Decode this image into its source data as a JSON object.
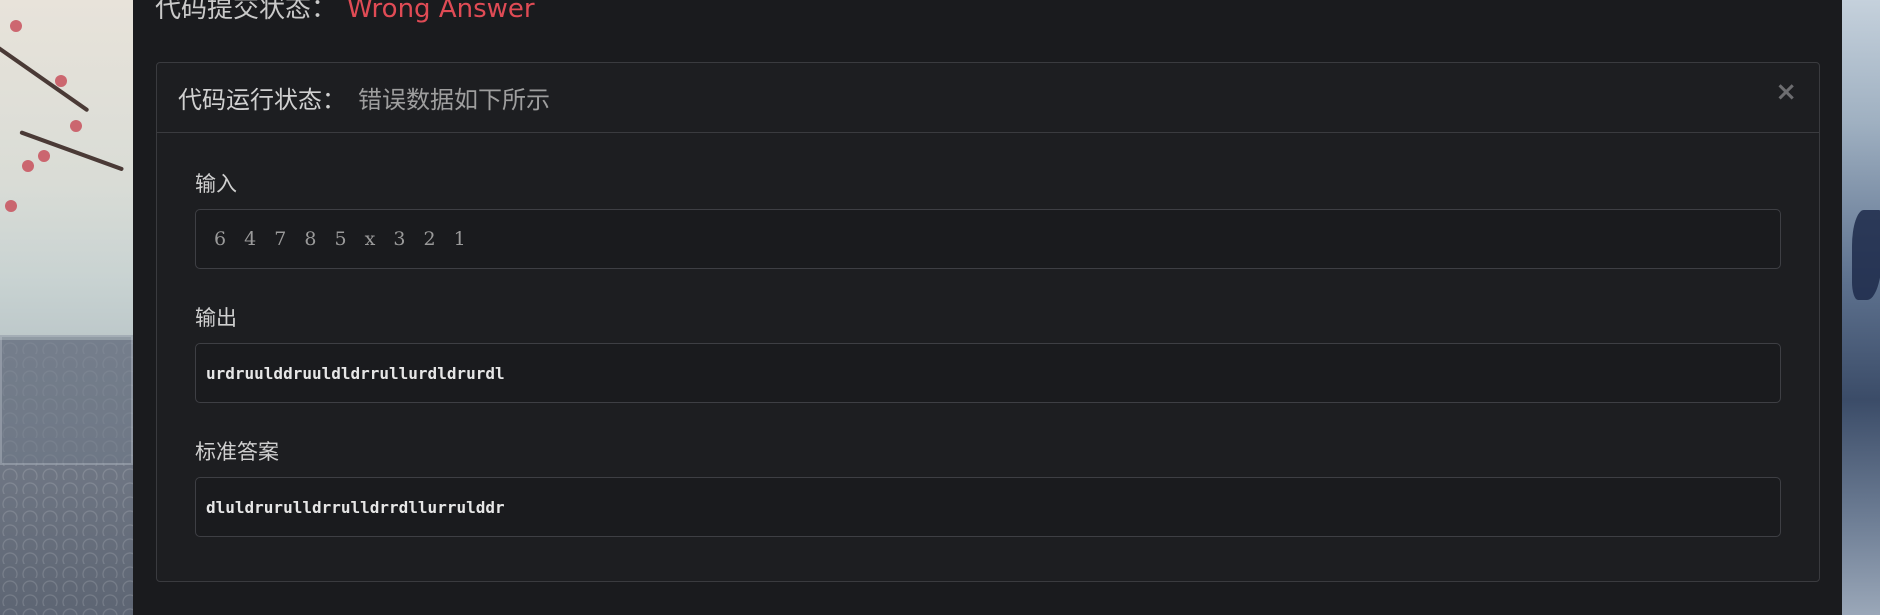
{
  "submission": {
    "label": "代码提交状态：",
    "status": "Wrong Answer"
  },
  "modal": {
    "title": "代码运行状态：",
    "subtitle": "错误数据如下所示",
    "close_icon": "×"
  },
  "fields": {
    "input": {
      "label": "输入",
      "value": "6 4 7 8 5 x 3 2 1"
    },
    "output": {
      "label": "输出",
      "value": "urdruulddruuldldrrullurdldrurdl"
    },
    "expected": {
      "label": "标准答案",
      "value": "dluldrurulldrrulldrrdllurrulddr"
    }
  },
  "colors": {
    "status_wrong": "#e04b55",
    "panel_bg": "#1a1b1e"
  }
}
